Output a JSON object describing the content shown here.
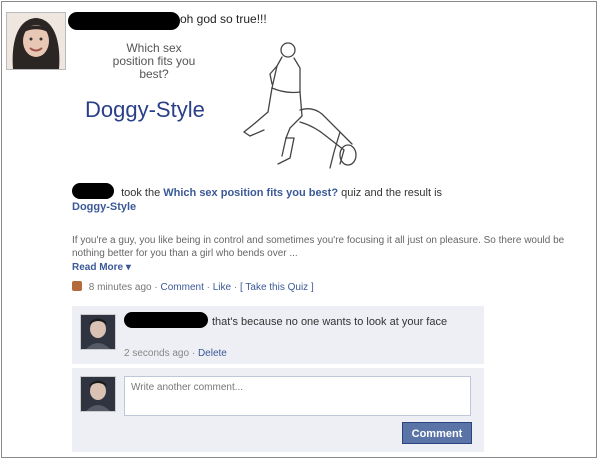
{
  "status": {
    "text": "oh god so true!!!"
  },
  "quiz_image": {
    "question": "Which sex position fits you best?",
    "result": "Doggy-Style"
  },
  "story": {
    "took_the": "took the",
    "quiz_name": "Which sex position fits you best?",
    "middle": "quiz and the result is",
    "result": "Doggy-Style",
    "description": "If you're a guy, you like being in control and sometimes you're focusing it all just on pleasure. So there would be nothing better for you than a girl who bends over ...",
    "read_more": "Read More",
    "time": "8 minutes ago",
    "comment": "Comment",
    "like": "Like",
    "take_quiz": "[ Take this Quiz ]"
  },
  "comment": {
    "text": "that's because no one wants to look at your face",
    "time": "2 seconds ago",
    "delete": "Delete"
  },
  "composer": {
    "placeholder": "Write another comment...",
    "button": "Comment"
  },
  "colors": {
    "link": "#3b5998",
    "comment_bg": "#edeff4",
    "button": "#5b74a8"
  }
}
